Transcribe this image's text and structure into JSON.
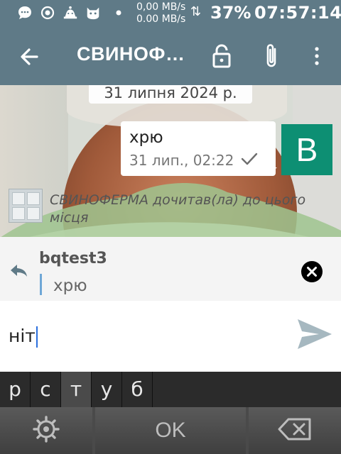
{
  "status_bar": {
    "net_up": "0,00 MB/s",
    "net_down": "0.00 MB/s",
    "battery": "37%",
    "time": "07:57:14",
    "icons": [
      "chat-bubble-icon",
      "record-icon",
      "android-debug-icon",
      "cat-app-icon",
      "dot-icon",
      "transfer-arrows-icon"
    ]
  },
  "app_bar": {
    "title": "СВИНОФ…",
    "icons": [
      "back-arrow-icon",
      "lock-icon",
      "paperclip-icon",
      "more-vert-icon"
    ],
    "color": "#5f7a87"
  },
  "chat": {
    "date_label": "31 липня 2024 р.",
    "message": {
      "text": "хрю",
      "time": "31 лип., 02:22",
      "status_icon": "check-icon"
    },
    "avatar_letter": "B",
    "avatar_color": "#0d8f73",
    "read_marker": "СВИНОФЕРМА дочитав(ла) до цього місця"
  },
  "reply": {
    "author": "bqtest3",
    "quoted_text": "хрю",
    "icons": [
      "reply-icon",
      "close-icon"
    ]
  },
  "input": {
    "value": "ніт",
    "send_icon": "send-icon"
  },
  "keyboard": {
    "candidates": [
      "р",
      "с",
      "т",
      "у",
      "б"
    ],
    "selected_index": 2,
    "soft_keys": {
      "left_icon": "settings-icon",
      "center_label": "OK",
      "right_icon": "backspace-icon"
    }
  }
}
